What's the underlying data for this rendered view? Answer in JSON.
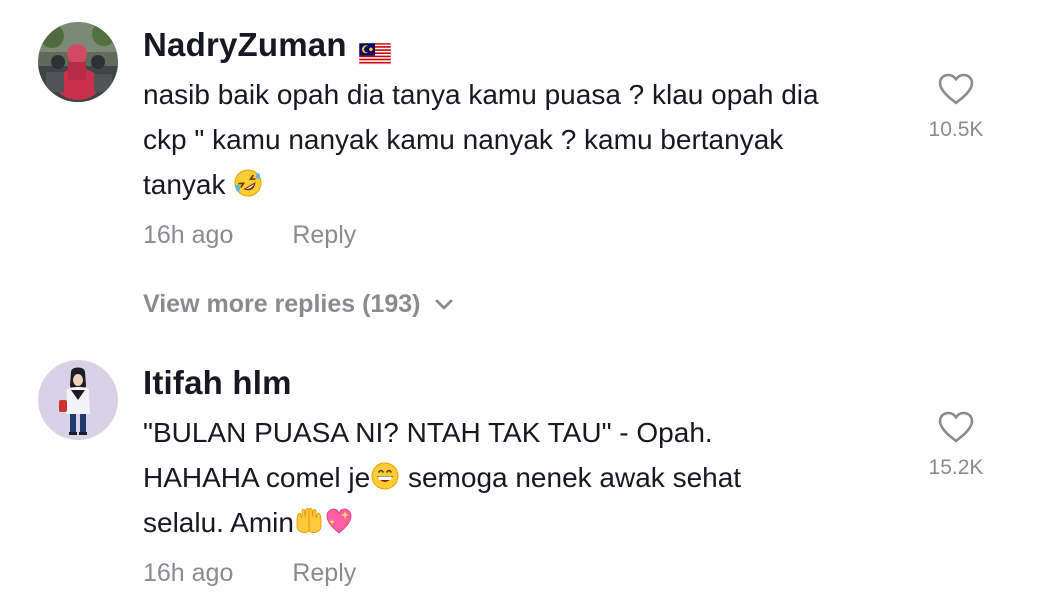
{
  "comments": [
    {
      "username": "NadryZuman",
      "flag_icon": "malaysia-flag-icon",
      "text_lines": [
        "nasib baik opah dia tanya kamu puasa ? klau opah dia",
        "ckp \" kamu nanyak kamu nanyak ? kamu bertanyak",
        "tanyak"
      ],
      "emoji": "rolling-on-floor-laughing-emoji",
      "time": "16h ago",
      "reply_label": "Reply",
      "like_count": "10.5K",
      "like_icon": "heart-outline-icon"
    },
    {
      "username": "Itifah hlm",
      "text_lines": [
        "\"BULAN PUASA NI? NTAH TAK TAU\" - Opah.",
        "HAHAHA comel je",
        "semoga nenek awak sehat",
        "selalu. Amin"
      ],
      "emojis": [
        "grinning-face-emoji",
        "raising-hands-emoji",
        "sparkling-heart-emoji"
      ],
      "time": "16h ago",
      "reply_label": "Reply",
      "like_count": "15.2K",
      "like_icon": "heart-outline-icon"
    }
  ],
  "view_more": {
    "label": "View more replies (193)",
    "icon": "chevron-down-icon"
  },
  "colors": {
    "text": "#161823",
    "muted": "#8a8b91",
    "background": "#ffffff"
  }
}
